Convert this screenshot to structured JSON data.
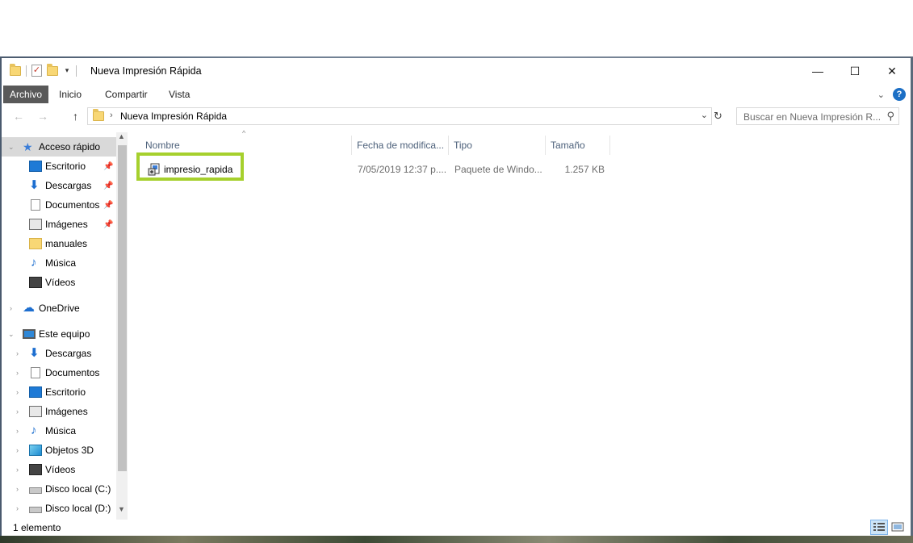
{
  "window": {
    "title": "Nueva Impresión Rápida",
    "controls": {
      "minimize": "—",
      "maximize": "☐",
      "close": "✕"
    }
  },
  "quick_access_toolbar": {
    "icons": [
      "folder-icon",
      "properties-check-icon",
      "new-folder-icon",
      "customize-dropdown-icon"
    ]
  },
  "ribbon": {
    "tabs": [
      "Archivo",
      "Inicio",
      "Compartir",
      "Vista"
    ],
    "expand_icon": "chevron-down-icon",
    "help_label": "?"
  },
  "navigation": {
    "back": "←",
    "forward": "→",
    "up": "↑",
    "address": "Nueva Impresión Rápida",
    "refresh": "↻",
    "search_placeholder": "Buscar en Nueva Impresión R..."
  },
  "nav_pane": {
    "quick_access": {
      "label": "Acceso rápido",
      "items": [
        {
          "label": "Escritorio",
          "icon": "desktop-icon",
          "pinned": true
        },
        {
          "label": "Descargas",
          "icon": "downloads-icon",
          "pinned": true
        },
        {
          "label": "Documentos",
          "icon": "documents-icon",
          "pinned": true
        },
        {
          "label": "Imágenes",
          "icon": "pictures-icon",
          "pinned": true
        },
        {
          "label": "manuales",
          "icon": "folder-icon",
          "pinned": false
        },
        {
          "label": "Música",
          "icon": "music-icon",
          "pinned": false
        },
        {
          "label": "Vídeos",
          "icon": "videos-icon",
          "pinned": false
        }
      ]
    },
    "onedrive": {
      "label": "OneDrive"
    },
    "this_pc": {
      "label": "Este equipo",
      "items": [
        {
          "label": "Descargas",
          "icon": "downloads-icon"
        },
        {
          "label": "Documentos",
          "icon": "documents-icon"
        },
        {
          "label": "Escritorio",
          "icon": "desktop-icon"
        },
        {
          "label": "Imágenes",
          "icon": "pictures-icon"
        },
        {
          "label": "Música",
          "icon": "music-icon"
        },
        {
          "label": "Objetos 3D",
          "icon": "3d-objects-icon"
        },
        {
          "label": "Vídeos",
          "icon": "videos-icon"
        },
        {
          "label": "Disco local (C:)",
          "icon": "drive-icon"
        },
        {
          "label": "Disco local (D:)",
          "icon": "drive-icon"
        }
      ]
    }
  },
  "file_list": {
    "columns": [
      "Nombre",
      "Fecha de modifica...",
      "Tipo",
      "Tamaño"
    ],
    "sort_column": "Nombre",
    "rows": [
      {
        "name": "impresio_rapida",
        "modified": "7/05/2019 12:37 p....",
        "type": "Paquete de Windo...",
        "size": "1.257 KB",
        "icon": "windows-installer-package-icon",
        "highlighted": true
      }
    ],
    "highlight_color": "#a6d02d"
  },
  "status_bar": {
    "item_count": "1 elemento",
    "view_modes": [
      "details-view-icon",
      "large-icons-view-icon"
    ],
    "active_view": "details-view-icon"
  },
  "colors": {
    "file_tab_bg": "#595959",
    "selection_bg": "#d9d9d9",
    "accent": "#1e6fd0"
  }
}
